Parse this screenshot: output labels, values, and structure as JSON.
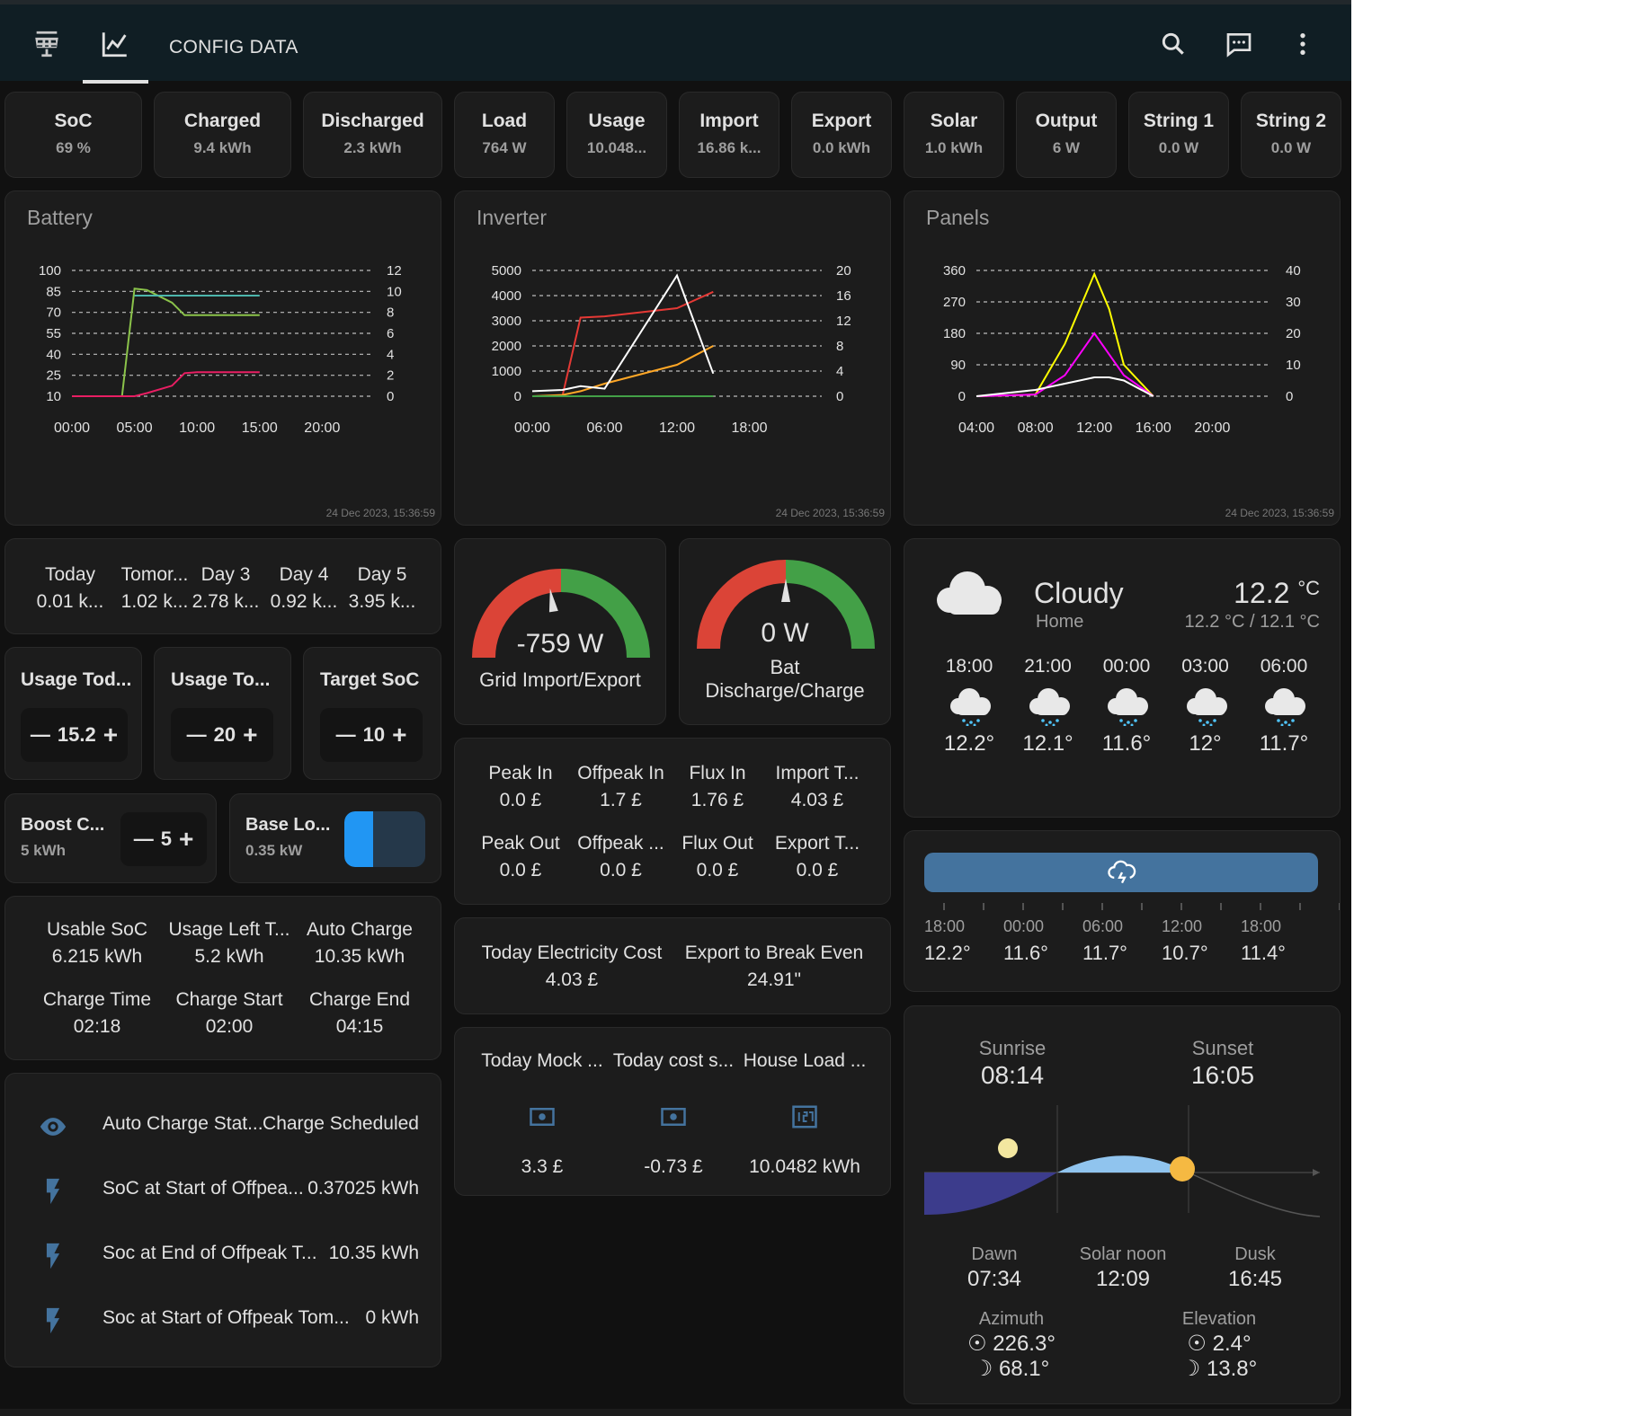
{
  "topbar": {
    "title": "CONFIG DATA",
    "icons": [
      "solar-panel-icon",
      "chart-line-icon",
      "search-icon",
      "chat-icon",
      "more-vert-icon"
    ]
  },
  "chips": [
    {
      "title": "SoC",
      "value": "69 %"
    },
    {
      "title": "Charged",
      "value": "9.4 kWh"
    },
    {
      "title": "Discharged",
      "value": "2.3 kWh"
    },
    {
      "title": "Load",
      "value": "764 W"
    },
    {
      "title": "Usage",
      "value": "10.048..."
    },
    {
      "title": "Import",
      "value": "16.86 k..."
    },
    {
      "title": "Export",
      "value": "0.0 kWh"
    },
    {
      "title": "Solar",
      "value": "1.0 kWh"
    },
    {
      "title": "Output",
      "value": "6 W"
    },
    {
      "title": "String 1",
      "value": "0.0 W"
    },
    {
      "title": "String 2",
      "value": "0.0 W"
    }
  ],
  "charts": {
    "battery": {
      "title": "Battery",
      "timestamp": "24 Dec 2023, 15:36:59",
      "left_ticks": [
        "100",
        "85",
        "70",
        "55",
        "40",
        "25",
        "10"
      ],
      "right_ticks": [
        "12",
        "10",
        "8",
        "6",
        "4",
        "2",
        "0"
      ],
      "x_ticks": [
        "00:00",
        "05:00",
        "10:00",
        "15:00",
        "20:00"
      ]
    },
    "inverter": {
      "title": "Inverter",
      "timestamp": "24 Dec 2023, 15:36:59",
      "left_ticks": [
        "5000",
        "4000",
        "3000",
        "2000",
        "1000",
        "0"
      ],
      "right_ticks": [
        "20",
        "16",
        "12",
        "8",
        "4",
        "0"
      ],
      "x_ticks": [
        "00:00",
        "06:00",
        "12:00",
        "18:00"
      ]
    },
    "panels": {
      "title": "Panels",
      "timestamp": "24 Dec 2023, 15:36:59",
      "left_ticks": [
        "360",
        "270",
        "180",
        "90",
        "0"
      ],
      "right_ticks": [
        "40",
        "30",
        "20",
        "10",
        "0"
      ],
      "x_ticks": [
        "04:00",
        "08:00",
        "12:00",
        "16:00",
        "20:00"
      ]
    }
  },
  "chart_data": [
    {
      "type": "line",
      "title": "Battery",
      "x": [
        "00:00",
        "02:00",
        "04:00",
        "05:00",
        "06:00",
        "08:00",
        "09:00",
        "10:00",
        "12:00",
        "15:00"
      ],
      "series": [
        {
          "color": "#8bc34a",
          "values": [
            10,
            10,
            10,
            87,
            86,
            77,
            68,
            68,
            68,
            68
          ]
        },
        {
          "color": "#4db6ac",
          "values": [
            null,
            null,
            null,
            82,
            82,
            82,
            82,
            82,
            82,
            82
          ]
        },
        {
          "color": "#e91e63",
          "values": [
            0,
            0,
            0,
            0,
            0.3,
            1,
            2.2,
            2.3,
            2.3,
            2.3
          ]
        }
      ],
      "ylim": [
        10,
        100
      ],
      "y2lim": [
        0,
        12
      ]
    },
    {
      "type": "line",
      "title": "Inverter",
      "x": [
        "00:00",
        "02:30",
        "04:00",
        "06:00",
        "12:00",
        "15:00"
      ],
      "series": [
        {
          "color": "#e53935",
          "values": [
            0,
            0,
            12.5,
            12.7,
            14,
            16.6
          ]
        },
        {
          "color": "#ffa726",
          "values": [
            0,
            0.2,
            0.8,
            2,
            5,
            8
          ]
        },
        {
          "color": "#ffffff",
          "values": [
            200,
            250,
            400,
            300,
            4800,
            900
          ]
        },
        {
          "color": "#43a047",
          "values": [
            0,
            0,
            0,
            0,
            0,
            0
          ]
        }
      ],
      "ylim": [
        0,
        5000
      ],
      "y2lim": [
        0,
        20
      ]
    },
    {
      "type": "line",
      "title": "Panels",
      "x": [
        "04:00",
        "08:00",
        "10:00",
        "12:00",
        "13:00",
        "14:00",
        "16:00"
      ],
      "series": [
        {
          "color": "#ffff00",
          "values": [
            0,
            5,
            150,
            350,
            250,
            90,
            0
          ]
        },
        {
          "color": "#ff00ff",
          "values": [
            0,
            5,
            60,
            180,
            120,
            60,
            0
          ]
        },
        {
          "color": "#ffffff",
          "values": [
            0,
            2,
            4,
            6,
            6,
            5,
            0
          ]
        }
      ],
      "ylim": [
        0,
        360
      ],
      "y2lim": [
        0,
        40
      ]
    }
  ],
  "forecast": [
    {
      "day": "Today",
      "val": "0.01 k..."
    },
    {
      "day": "Tomor...",
      "val": "1.02 k..."
    },
    {
      "day": "Day 3",
      "val": "2.78 k..."
    },
    {
      "day": "Day 4",
      "val": "0.92 k..."
    },
    {
      "day": "Day 5",
      "val": "3.95 k..."
    }
  ],
  "steppers": [
    {
      "title": "Usage Tod...",
      "value": "15.2"
    },
    {
      "title": "Usage To...",
      "value": "20"
    },
    {
      "title": "Target SoC",
      "value": "10"
    }
  ],
  "boost": {
    "title": "Boost C...",
    "sub": "5 kWh",
    "value": "5"
  },
  "base_load": {
    "title": "Base Lo...",
    "sub": "0.35 kW"
  },
  "soc_info": [
    {
      "label": "Usable SoC",
      "value": "6.215 kWh"
    },
    {
      "label": "Usage Left T...",
      "value": "5.2 kWh"
    },
    {
      "label": "Auto Charge",
      "value": "10.35 kWh"
    },
    {
      "label": "Charge Time",
      "value": "02:18"
    },
    {
      "label": "Charge Start",
      "value": "02:00"
    },
    {
      "label": "Charge End",
      "value": "04:15"
    }
  ],
  "entities": [
    {
      "name": "Auto Charge Stat...",
      "value": "Charge Scheduled",
      "icon": "eye-icon"
    },
    {
      "name": "SoC at Start of Offpea...",
      "value": "0.37025 kWh",
      "icon": "flash-icon"
    },
    {
      "name": "Soc at End of Offpeak T...",
      "value": "10.35 kWh",
      "icon": "flash-icon"
    },
    {
      "name": "Soc at Start of Offpeak Tom...",
      "value": "0 kWh",
      "icon": "flash-icon"
    }
  ],
  "gauges": {
    "grid": {
      "value": "-759 W",
      "label": "Grid Import/Export",
      "level": -0.1
    },
    "battery": {
      "value": "0 W",
      "label1": "Bat",
      "label2": "Discharge/Charge",
      "level": 0
    }
  },
  "tariff": [
    {
      "label": "Peak In",
      "value": "0.0 £"
    },
    {
      "label": "Offpeak In",
      "value": "1.7 £"
    },
    {
      "label": "Flux In",
      "value": "1.76 £"
    },
    {
      "label": "Import T...",
      "value": "4.03 £"
    },
    {
      "label": "Peak Out",
      "value": "0.0 £"
    },
    {
      "label": "Offpeak ...",
      "value": "0.0 £"
    },
    {
      "label": "Flux Out",
      "value": "0.0 £"
    },
    {
      "label": "Export T...",
      "value": "0.0 £"
    }
  ],
  "cost": [
    {
      "label": "Today Electricity Cost",
      "value": "4.03 £"
    },
    {
      "label": "Export to Break Even",
      "value": "24.91\""
    }
  ],
  "mock": [
    {
      "label": "Today Mock ...",
      "value": "3.3 £",
      "icon": "cash-icon"
    },
    {
      "label": "Today cost s...",
      "value": "-0.73 £",
      "icon": "cash-icon"
    },
    {
      "label": "House Load ...",
      "value": "10.0482 kWh",
      "icon": "counter-icon"
    }
  ],
  "weather": {
    "condition": "Cloudy",
    "location": "Home",
    "temp": "12.2",
    "unit": "°C",
    "range": "12.2 °C / 12.1 °C",
    "hourly": [
      {
        "time": "18:00",
        "temp": "12.2°"
      },
      {
        "time": "21:00",
        "temp": "12.1°"
      },
      {
        "time": "00:00",
        "temp": "11.6°"
      },
      {
        "time": "03:00",
        "temp": "12°"
      },
      {
        "time": "06:00",
        "temp": "11.7°"
      }
    ]
  },
  "timeline": [
    {
      "time": "18:00",
      "temp": "12.2°"
    },
    {
      "time": "00:00",
      "temp": "11.6°"
    },
    {
      "time": "06:00",
      "temp": "11.7°"
    },
    {
      "time": "12:00",
      "temp": "10.7°"
    },
    {
      "time": "18:00",
      "temp": "11.4°"
    }
  ],
  "sun": {
    "sunrise_label": "Sunrise",
    "sunrise": "08:14",
    "sunset_label": "Sunset",
    "sunset": "16:05",
    "dawn_label": "Dawn",
    "dawn": "07:34",
    "noon_label": "Solar noon",
    "noon": "12:09",
    "dusk_label": "Dusk",
    "dusk": "16:45",
    "azimuth_label": "Azimuth",
    "azimuth_sun": "226.3°",
    "azimuth_moon": "68.1°",
    "elevation_label": "Elevation",
    "elevation_sun": "2.4°",
    "elevation_moon": "13.8°"
  },
  "colors": {
    "accent": "#2196f3",
    "green": "#43a047",
    "red": "#db4437",
    "header": "#101e24",
    "card": "#1c1c1c"
  }
}
